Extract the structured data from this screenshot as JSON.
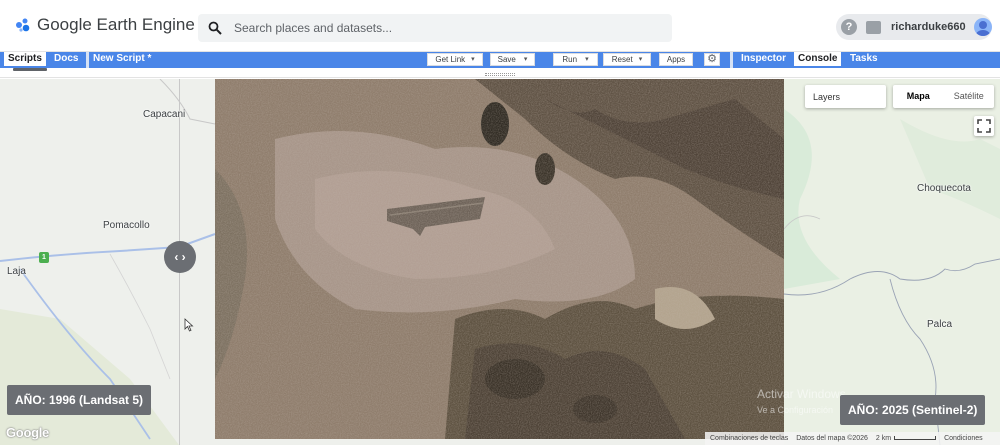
{
  "app": {
    "title": "Google Earth Engine"
  },
  "search": {
    "placeholder": "Search places and datasets..."
  },
  "user": {
    "name": "richarduke660",
    "help_glyph": "?"
  },
  "toolbar": {
    "left_tabs": [
      "Scripts",
      "Docs"
    ],
    "script_name": "New Script *",
    "buttons": {
      "get_link": "Get Link",
      "save": "Save",
      "run": "Run",
      "reset": "Reset",
      "apps": "Apps"
    },
    "right_tabs": [
      "Inspector",
      "Console",
      "Tasks"
    ],
    "active_left_tab": "Scripts",
    "active_right_tab": "Console"
  },
  "map": {
    "places": {
      "capacani": "Capacani",
      "pomacollo": "Pomacollo",
      "laja": "Laja",
      "choquecota": "Choquecota",
      "palca": "Palca"
    },
    "road_shield": "1",
    "layers_label": "Layers",
    "map_types": [
      "Mapa",
      "Satélite"
    ],
    "active_map_type": "Mapa",
    "swipe_glyph": "‹ ›",
    "label_left": "AÑO: 1996 (Landsat 5)",
    "label_right": "AÑO: 2025 (Sentinel-2)",
    "watermark": {
      "line1": "Activar Windows",
      "line2": "Ve a Configuración"
    },
    "google_logo": "Google",
    "attribution": {
      "shortcuts": "Combinaciones de teclas",
      "data": "Datos del mapa ©2026",
      "scale": "2 km",
      "terms": "Condiciones"
    }
  },
  "colors": {
    "toolbar": "#4a86e8",
    "year_label_bg": "#6b6e73",
    "map_bg": "#eef0ec"
  }
}
